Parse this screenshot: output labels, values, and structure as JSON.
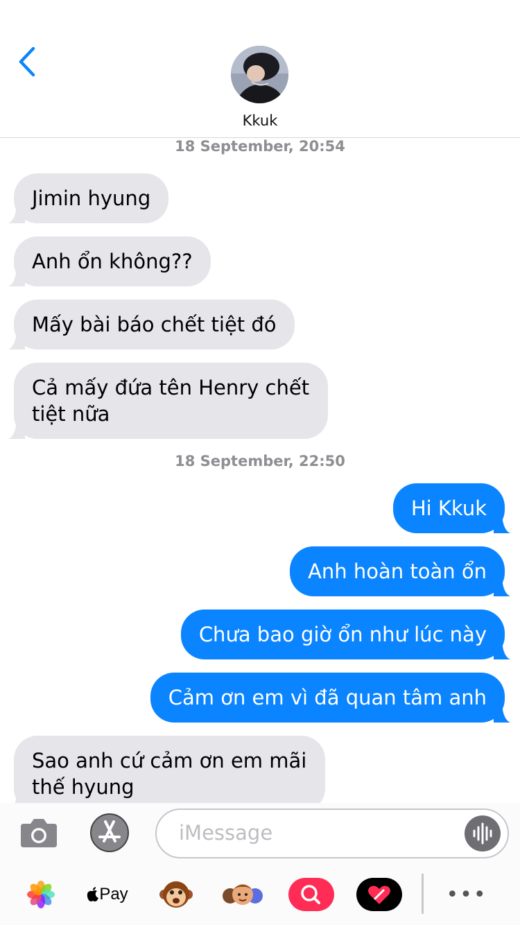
{
  "contact": {
    "name": "Kkuk"
  },
  "composer": {
    "placeholder": "iMessage"
  },
  "tray": {
    "applepay_label": "Pay",
    "more_label": "•••"
  },
  "thread": {
    "stamp_1": "18 September, 20:54",
    "stamp_2": "18 September, 22:50",
    "messages": [
      {
        "from": "contact",
        "text_lines": [
          "Jimin hyung"
        ]
      },
      {
        "from": "contact",
        "text_lines": [
          "Anh ổn không??"
        ]
      },
      {
        "from": "contact",
        "text_lines": [
          "Mấy bài báo chết tiệt đó"
        ]
      },
      {
        "from": "contact",
        "text_lines": [
          "Cả mấy đứa tên Henry chết",
          "tiệt nữa"
        ]
      },
      {
        "from": "me",
        "text_lines": [
          "Hi Kkuk"
        ]
      },
      {
        "from": "me",
        "text_lines": [
          "Anh hoàn toàn ổn"
        ]
      },
      {
        "from": "me",
        "text_lines": [
          "Chưa bao giờ ổn như lúc này"
        ]
      },
      {
        "from": "me",
        "text_lines": [
          "Cảm ơn em vì đã quan tâm anh"
        ]
      },
      {
        "from": "contact",
        "text_lines": [
          "Sao anh cứ cảm ơn em mãi",
          "thế hyung"
        ]
      }
    ]
  },
  "colors": {
    "accent": "#0b84ff",
    "incoming_bubble": "#e5e5ea",
    "timestamp": "#8e8e93",
    "battery": "#ffcc00"
  }
}
